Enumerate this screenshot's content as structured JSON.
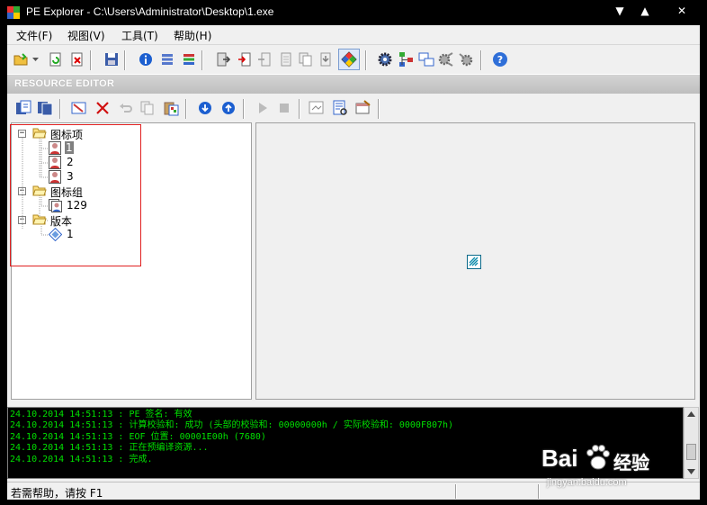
{
  "window": {
    "title": "PE Explorer - C:\\Users\\Administrator\\Desktop\\1.exe",
    "controls": {
      "minimize": "▼",
      "maximize": "▲",
      "close": "✕"
    }
  },
  "menu": [
    "文件(F)",
    "视图(V)",
    "工具(T)",
    "帮助(H)"
  ],
  "resource_editor": {
    "title": "RESOURCE EDITOR"
  },
  "tree": {
    "groups": [
      {
        "label": "图标项",
        "items": [
          "1",
          "2",
          "3"
        ]
      },
      {
        "label": "图标组",
        "items": [
          "129"
        ]
      },
      {
        "label": "版本",
        "items": [
          "1"
        ]
      }
    ]
  },
  "log": [
    "24.10.2014 14:51:13 : PE 签名: 有效",
    "24.10.2014 14:51:13 : 计算校验和: 成功 (头部的校验和: 00000000h / 实际校验和: 0000F807h)",
    "24.10.2014 14:51:13 : EOF 位置: 00001E00h  (7680)",
    "24.10.2014 14:51:13 : 正在预编译资源...",
    "24.10.2014 14:51:13 : 完成."
  ],
  "status": {
    "text": "若需帮助，请按 F1"
  },
  "watermark": {
    "brand": "Bai",
    "brand2": "经验",
    "url": "jingyan.baidu.com"
  },
  "colors": {
    "log_text": "#00e000",
    "selection_box": "#e02020",
    "header_bg": "#c8c8c8"
  }
}
